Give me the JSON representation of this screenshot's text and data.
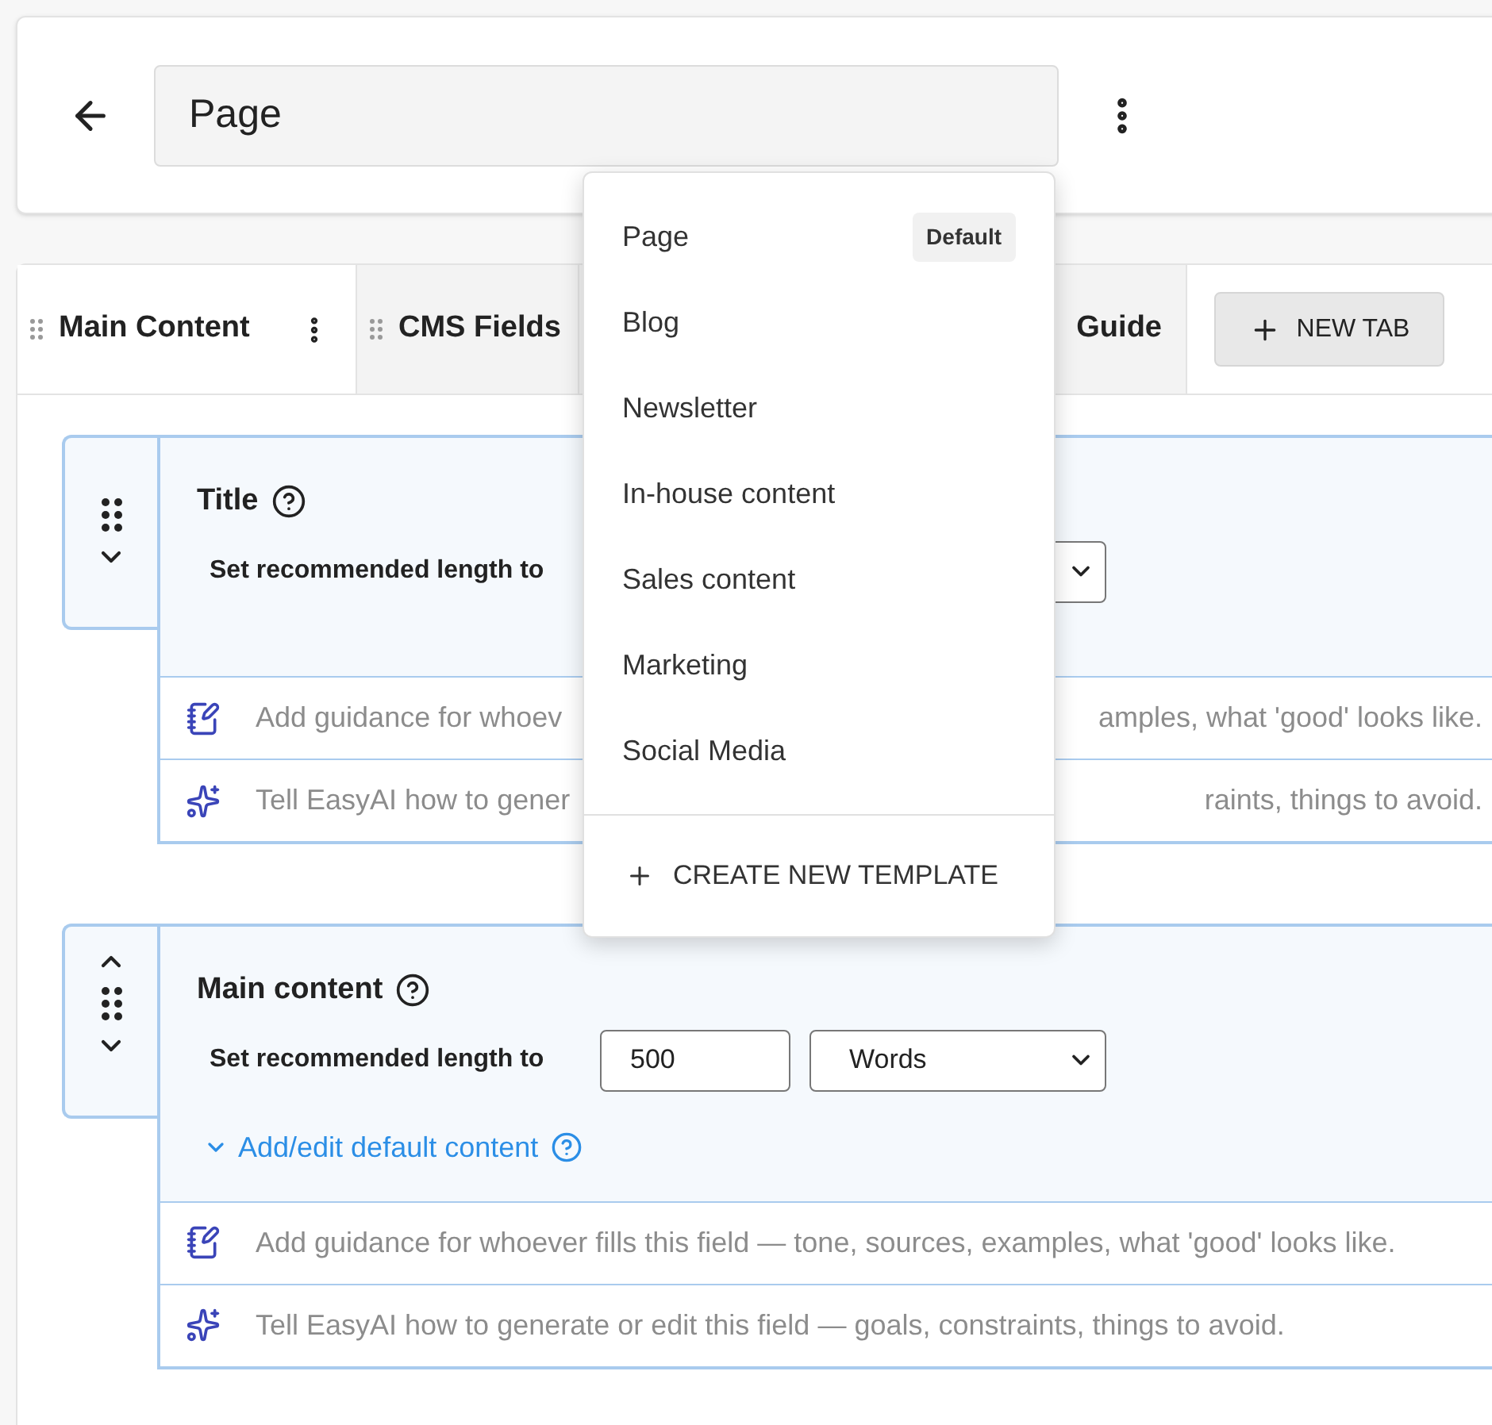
{
  "header": {
    "title_value": "Page"
  },
  "tabs": [
    {
      "label": "Main Content",
      "selected": true
    },
    {
      "label": "CMS Fields",
      "selected": false
    }
  ],
  "partial_tab": {
    "label": "Guide"
  },
  "new_tab_button": {
    "label": "NEW TAB"
  },
  "fields": [
    {
      "title": "Title",
      "length_label": "Set recommended length to",
      "can_move_up": false,
      "guidance": [
        "Add guidance for whoev",
        "amples, what 'good' looks like."
      ],
      "ai_prompt": [
        "Tell EasyAI how to gener",
        "raints, things to avoid."
      ]
    },
    {
      "title": "Main content",
      "length_label": "Set recommended length to",
      "can_move_up": true,
      "length_value": "500",
      "unit": "Words",
      "default_content_link": "Add/edit default content",
      "guidance": [
        "Add guidance for whoever fills this field — tone, sources, examples, what 'good' looks like."
      ],
      "ai_prompt": [
        "Tell EasyAI how to generate or edit this field — goals, constraints, things to avoid."
      ]
    }
  ],
  "template_menu": {
    "items": [
      {
        "label": "Page",
        "badge": "Default"
      },
      {
        "label": "Blog"
      },
      {
        "label": "Newsletter"
      },
      {
        "label": "In-house content"
      },
      {
        "label": "Sales content"
      },
      {
        "label": "Marketing"
      },
      {
        "label": "Social Media"
      }
    ],
    "create_label": "CREATE NEW TEMPLATE"
  }
}
